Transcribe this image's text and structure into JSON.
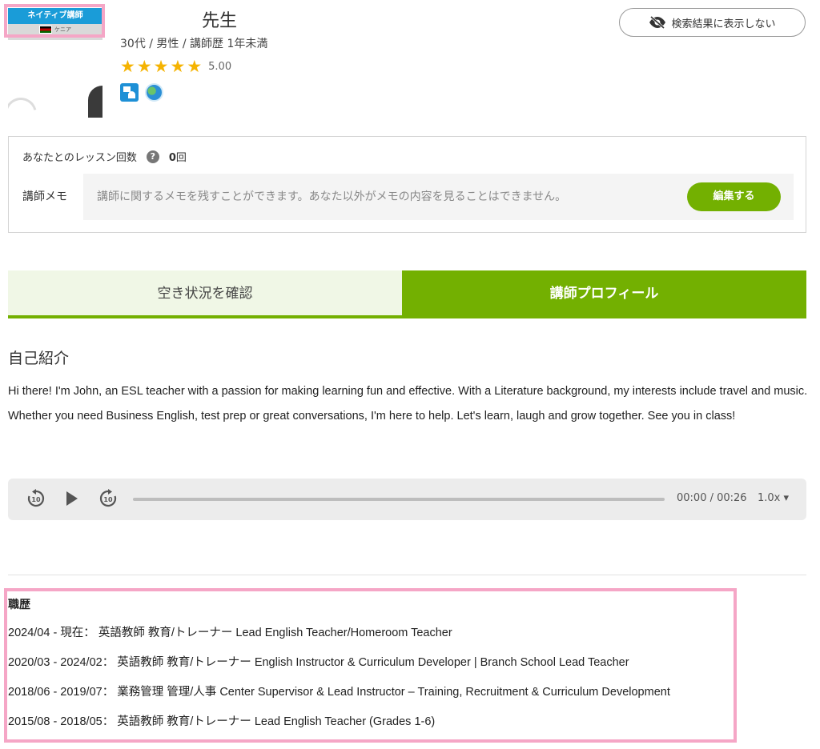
{
  "profile": {
    "badge_label": "ネイティブ講師",
    "country": "ケニア",
    "name": "先生",
    "meta": "30代 / 男性 / 講師歴 1年未満",
    "rating": "5.00",
    "stars": 5,
    "icons": [
      "lesson-icon",
      "globe-icon"
    ]
  },
  "header": {
    "hide_button_label": "検索結果に表示しない",
    "hide_icon": "eye-slash-icon"
  },
  "memo": {
    "lesson_count_label": "あなたとのレッスン回数",
    "lesson_count_value": "0",
    "lesson_count_unit": "回",
    "help_icon": "question-icon",
    "help_glyph": "?",
    "memo_label": "講師メモ",
    "placeholder": "講師に関するメモを残すことができます。あなた以外がメモの内容を見ることはできません。",
    "edit_label": "編集する"
  },
  "tabs": [
    {
      "label": "空き状況を確認",
      "active": false
    },
    {
      "label": "講師プロフィール",
      "active": true
    }
  ],
  "intro": {
    "title": "自己紹介",
    "text": "Hi there! I'm John, an ESL teacher with a passion for making learning fun and effective. With a Literature background, my interests include travel and music. Whether you need Business English, test prep or great conversations, I'm here to help. Let's learn, laugh and grow together. See you in class!"
  },
  "player": {
    "current_time": "00:00",
    "duration": "00:26",
    "time_display": "00:00 / 00:26",
    "speed": "1.0x ▾",
    "progress": 0
  },
  "career": {
    "title": "職歴",
    "items": [
      "2024/04 - 現在： 英語教師 教育/トレーナー Lead English Teacher/Homeroom Teacher",
      "2020/03 - 2024/02： 英語教師 教育/トレーナー English Instructor & Curriculum Developer | Branch School Lead Teacher",
      "2018/06 - 2019/07： 業務管理 管理/人事 Center Supervisor & Lead Instructor – Training, Recruitment & Curriculum Development",
      "2015/08 - 2018/05： 英語教師 教育/トレーナー Lead English Teacher (Grades 1-6)"
    ]
  },
  "colors": {
    "accent_green": "#73b001",
    "badge_blue": "#1a9cd8",
    "star": "#f5b301",
    "highlight_pink": "#f5a6c6"
  }
}
